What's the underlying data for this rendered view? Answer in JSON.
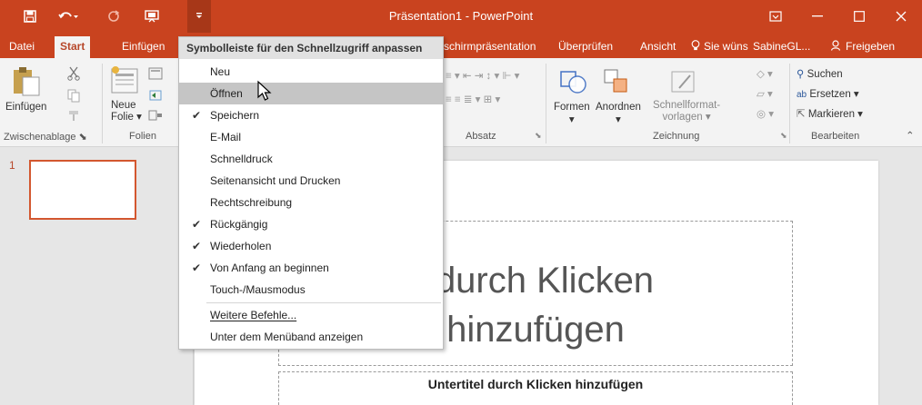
{
  "window": {
    "title": "Präsentation1 - PowerPoint",
    "customize_glyph": "≡"
  },
  "qat": {
    "save_glyph": "💾",
    "undo_glyph": "↶",
    "redo_glyph": "↻"
  },
  "tabs": {
    "file": "Datei",
    "start": "Start",
    "insert": "Einfügen",
    "slideshow": "schirmpräsentation",
    "review": "Überprüfen",
    "view": "Ansicht",
    "tell_me": "Sie wüns",
    "user": "SabineGL...",
    "share": "Freigeben"
  },
  "ribbon": {
    "paste": "Einfügen",
    "new_slide_line1": "Neue",
    "new_slide_line2": "Folie",
    "group_clipboard": "Zwischenablage",
    "group_slides": "Folien",
    "group_paragraph": "Absatz",
    "group_drawing": "Zeichnung",
    "group_editing": "Bearbeiten",
    "shapes": "Formen",
    "arrange": "Anordnen",
    "quickstyles_line1": "Schnellformat-",
    "quickstyles_line2": "vorlagen",
    "find": "Suchen",
    "replace": "Ersetzen",
    "select": "Markieren"
  },
  "menu": {
    "header": "Symbolleiste für den Schnellzugriff anpassen",
    "items": [
      {
        "label": "Neu",
        "checked": false
      },
      {
        "label": "Öffnen",
        "checked": false
      },
      {
        "label": "Speichern",
        "checked": true
      },
      {
        "label": "E-Mail",
        "checked": false
      },
      {
        "label": "Schnelldruck",
        "checked": false
      },
      {
        "label": "Seitenansicht und Drucken",
        "checked": false
      },
      {
        "label": "Rechtschreibung",
        "checked": false
      },
      {
        "label": "Rückgängig",
        "checked": true
      },
      {
        "label": "Wiederholen",
        "checked": true
      },
      {
        "label": "Von Anfang an beginnen",
        "checked": true
      },
      {
        "label": "Touch-/Mausmodus",
        "checked": false
      }
    ],
    "more_commands": "Weitere Befehle...",
    "show_below": "Unter dem Menüband anzeigen",
    "check_glyph": "✔"
  },
  "slides": {
    "thumb_number": "1",
    "title_line1": "l durch Klicken",
    "title_line2": "hinzufügen",
    "subtitle": "Untertitel durch Klicken hinzufügen"
  }
}
